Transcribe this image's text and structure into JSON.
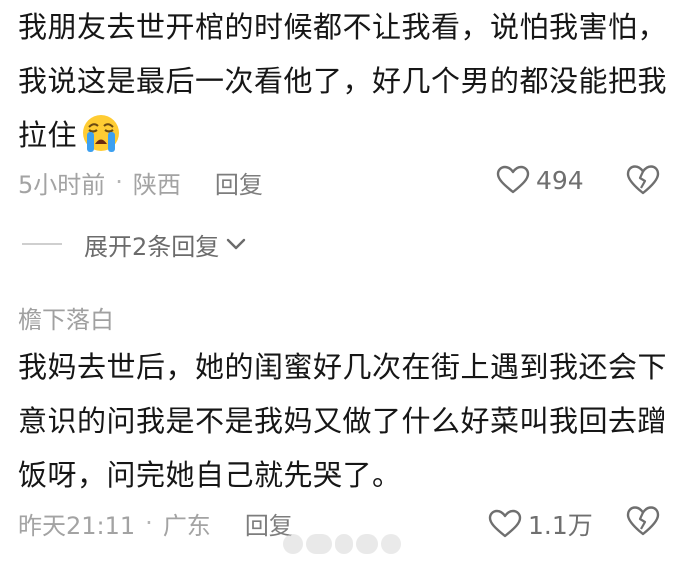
{
  "comment1": {
    "text": "我朋友去世开棺的时候都不让我看，说怕我害怕，我说这是最后一次看他了，好几个男的都没能把我拉住",
    "emoji": "loudly-crying-face",
    "time": "5小时前",
    "location": "陕西",
    "reply_label": "回复",
    "likes": "494"
  },
  "expand": {
    "label": "展开2条回复"
  },
  "comment2": {
    "username": "檐下落白",
    "text": "我妈去世后，她的闺蜜好几次在街上遇到我还会下意识的问我是不是我妈又做了什么好菜叫我回去蹭饭呀，问完她自己就先哭了。",
    "time": "昨天21:11",
    "location": "广东",
    "reply_label": "回复",
    "likes": "1.1万"
  },
  "separator": "·",
  "colors": {
    "text": "#161616",
    "meta": "#a3a3a3",
    "icon": "#6f6f6f",
    "background": "#ffffff"
  }
}
